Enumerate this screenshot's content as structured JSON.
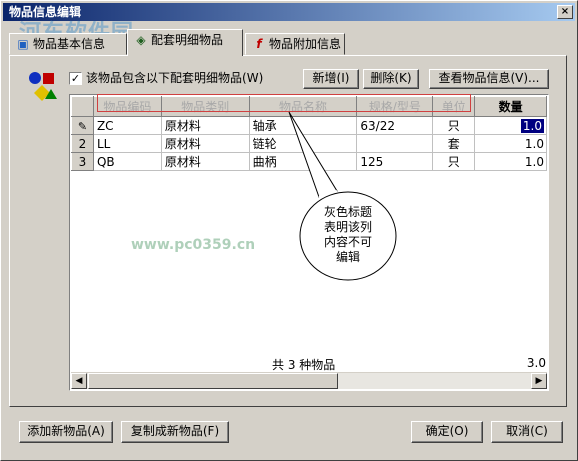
{
  "window": {
    "title": "物品信息编辑",
    "close_glyph": "×"
  },
  "watermark": {
    "text": "河东软件园",
    "url": "www.pc0359.cn"
  },
  "tabs": [
    {
      "label": "物品基本信息",
      "icon": "info-icon"
    },
    {
      "label": "配套明细物品",
      "icon": "parts-icon",
      "active": true
    },
    {
      "label": "物品附加信息",
      "icon": "function-icon",
      "icon_glyph": "f"
    }
  ],
  "detail": {
    "checkbox_label": "该物品包含以下配套明细物品",
    "checkbox_hotkey": "(W)",
    "checkbox_checked": true,
    "checkbox_glyph": "✓",
    "buttons": {
      "add": "新增(I)",
      "delete": "删除(K)",
      "view": "查看物品信息(V)..."
    }
  },
  "grid": {
    "columns": [
      {
        "key": "code",
        "label": "物品编码",
        "editable": false
      },
      {
        "key": "category",
        "label": "物品类别",
        "editable": false
      },
      {
        "key": "name",
        "label": "物品名称",
        "editable": false
      },
      {
        "key": "spec",
        "label": "规格/型号",
        "editable": false
      },
      {
        "key": "unit",
        "label": "单位",
        "editable": false
      },
      {
        "key": "qty",
        "label": "数量",
        "editable": true
      }
    ],
    "rows": [
      {
        "num": "",
        "code": "ZC",
        "category": "原材料",
        "name": "轴承",
        "spec": "63/22",
        "unit": "只",
        "qty": "1.0"
      },
      {
        "num": "2",
        "code": "LL",
        "category": "原材料",
        "name": "链轮",
        "spec": "",
        "unit": "套",
        "qty": "1.0"
      },
      {
        "num": "3",
        "code": "QB",
        "category": "原材料",
        "name": "曲柄",
        "spec": "125",
        "unit": "只",
        "qty": "1.0"
      }
    ],
    "footer": {
      "total_label": "共 3 种物品",
      "total_qty": "3.0"
    },
    "row_pointer_glyph": "✎"
  },
  "callout": {
    "line1": "灰色标题",
    "line2": "表明该列",
    "line3": "内容不可",
    "line4": "编辑"
  },
  "bottom_buttons": {
    "add_new": "添加新物品(A)",
    "copy_new": "复制成新物品(F)",
    "ok": "确定(O)",
    "cancel": "取消(C)"
  },
  "colors": {
    "title_start": "#0a246a",
    "title_end": "#a6caf0",
    "window_bg": "#d4d0c8",
    "selection": "#000080",
    "hint_outline": "#d04040",
    "disabled_header_text": "#a8a8a8"
  }
}
